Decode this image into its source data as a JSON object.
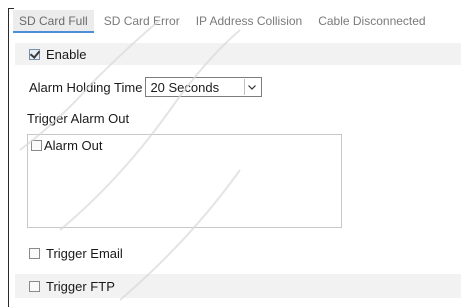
{
  "tabs": [
    {
      "label": "SD Card Full",
      "active": true
    },
    {
      "label": "SD Card Error",
      "active": false
    },
    {
      "label": "IP Address Collision",
      "active": false
    },
    {
      "label": "Cable Disconnected",
      "active": false
    }
  ],
  "enable": {
    "label": "Enable",
    "checked": true
  },
  "holding_time": {
    "label": "Alarm Holding Time",
    "selected": "20 Seconds"
  },
  "trigger_alarm_out": {
    "label": "Trigger Alarm Out"
  },
  "alarm_out": {
    "label": "Alarm Out",
    "checked": false
  },
  "trigger_email": {
    "label": "Trigger Email",
    "checked": false
  },
  "trigger_ftp": {
    "label": "Trigger FTP",
    "checked": false
  },
  "colors": {
    "accent": "#4a90d9",
    "row_shade": "#f2f2f2",
    "tab_bg": "#ececec"
  }
}
